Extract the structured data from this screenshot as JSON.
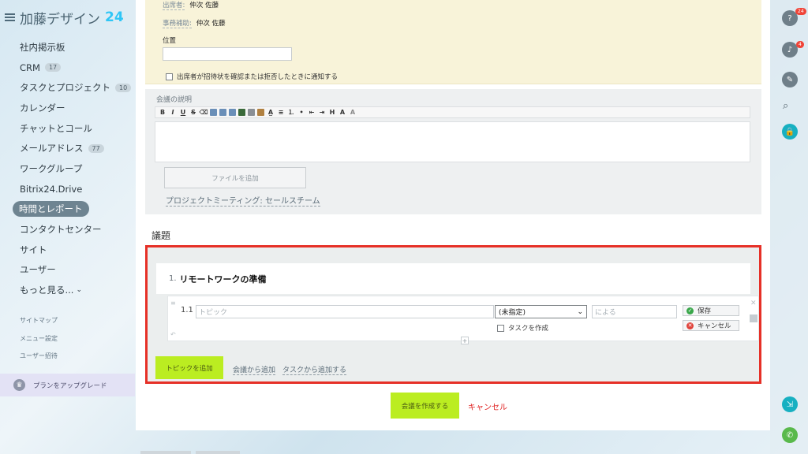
{
  "app": {
    "title": "加藤デザイン",
    "title_num": "24"
  },
  "sidebar": {
    "items": [
      {
        "label": "社内掲示板"
      },
      {
        "label": "CRM",
        "count": "17"
      },
      {
        "label": "タスクとプロジェクト",
        "count": "10"
      },
      {
        "label": "カレンダー"
      },
      {
        "label": "チャットとコール"
      },
      {
        "label": "メールアドレス",
        "count": "77"
      },
      {
        "label": "ワークグループ"
      },
      {
        "label": "Bitrix24.Drive"
      },
      {
        "label": "時間とレポート",
        "active": true
      },
      {
        "label": "コンタクトセンター"
      },
      {
        "label": "サイト"
      },
      {
        "label": "ユーザー"
      },
      {
        "label": "もっと見る..."
      }
    ],
    "more_arrow": "⌄",
    "small_links": [
      "サイトマップ",
      "メニュー設定",
      "ユーザー招待"
    ],
    "upgrade_label": "プランをアップグレード"
  },
  "meeting": {
    "attendees_label": "出席者:",
    "attendees_value": "仲次 佐藤",
    "assistant_label": "事務補助:",
    "assistant_value": "仲次 佐藤",
    "location_label": "位置",
    "location_value": "",
    "notify_label": "出席者が招待状を確認または拒否したときに通知する",
    "description_label": "会議の説明",
    "add_file_label": "ファイルを追加",
    "project_link": "プロジェクトミーティング: セールスチーム"
  },
  "toolbar": {
    "bold": "B",
    "italic": "I",
    "underline": "U",
    "strike": "S",
    "heading": "H",
    "font_size": "A",
    "font_color": "A"
  },
  "agenda": {
    "title": "議題",
    "topic_num": "1.",
    "topic_title": "リモートワークの準備",
    "subtopic_num": "1.1",
    "topic_placeholder": "トピック",
    "responsible_value": "(未指定)",
    "by_placeholder": "による",
    "create_task_label": "タスクを作成",
    "save_label": "保存",
    "cancel_label": "キャンセル",
    "add_topic_label": "トピックを追加",
    "from_meeting_label": "会議から追加",
    "from_task_label": "タスクから追加する"
  },
  "footer": {
    "create_label": "会議を作成する",
    "cancel_label": "キャンセル"
  },
  "rightbar": {
    "help_badge": "24",
    "notif_badge": "4"
  },
  "colors": {
    "accent_green": "#bbed21",
    "highlight_red": "#e63027",
    "link_blue": "#2fc6f6"
  }
}
